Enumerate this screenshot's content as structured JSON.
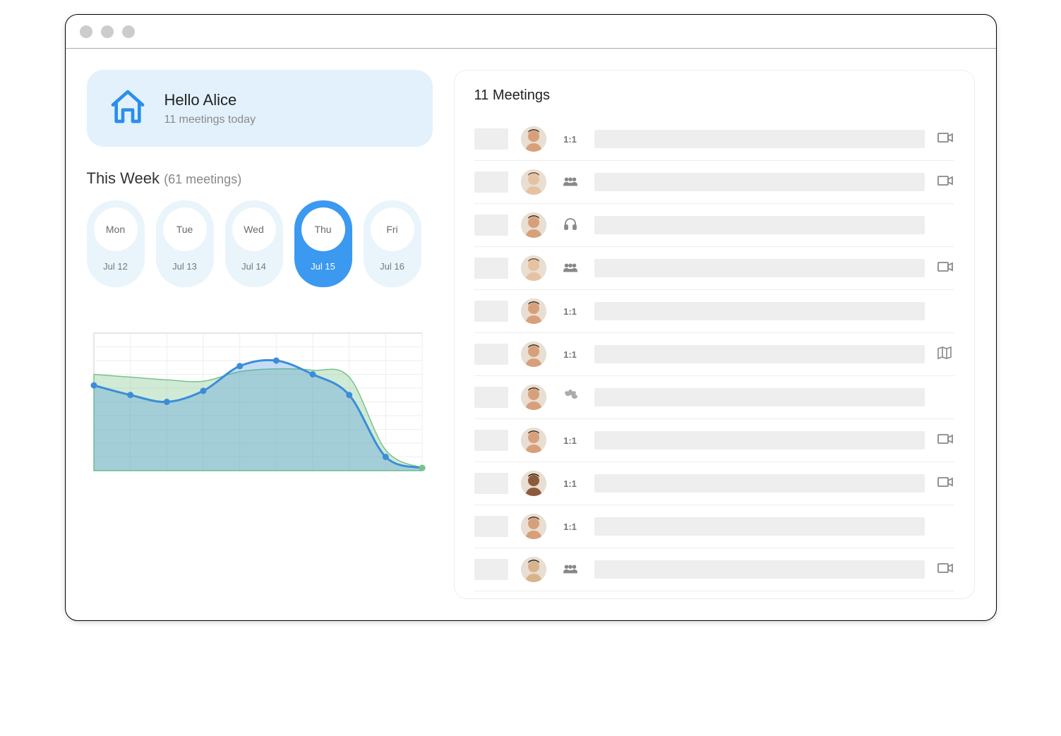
{
  "greeting": {
    "title": "Hello Alice",
    "subtitle": "11 meetings today"
  },
  "week": {
    "label": "This Week",
    "count_label": "(61 meetings)",
    "days": [
      {
        "dow": "Mon",
        "date": "Jul 12",
        "active": false
      },
      {
        "dow": "Tue",
        "date": "Jul 13",
        "active": false
      },
      {
        "dow": "Wed",
        "date": "Jul 14",
        "active": false
      },
      {
        "dow": "Thu",
        "date": "Jul 15",
        "active": true
      },
      {
        "dow": "Fri",
        "date": "Jul 16",
        "active": false
      }
    ]
  },
  "chart_data": {
    "type": "area",
    "x": [
      0,
      1,
      2,
      3,
      4,
      5,
      6,
      7,
      8,
      9
    ],
    "series": [
      {
        "name": "series-blue",
        "color": "#3b8dd9",
        "values": [
          62,
          55,
          50,
          58,
          76,
          80,
          70,
          55,
          10,
          2
        ]
      },
      {
        "name": "series-green",
        "color": "#79c28a",
        "values": [
          70,
          68,
          66,
          65,
          72,
          74,
          73,
          68,
          15,
          2
        ]
      }
    ],
    "ylim": [
      0,
      100
    ],
    "title": "",
    "xlabel": "",
    "ylabel": ""
  },
  "meetings": {
    "heading": "11 Meetings",
    "rows": [
      {
        "avatar": "f1",
        "type": "1:1",
        "action": "video"
      },
      {
        "avatar": "m1",
        "type": "group",
        "action": "video"
      },
      {
        "avatar": "f1",
        "type": "audio",
        "action": ""
      },
      {
        "avatar": "m1",
        "type": "group",
        "action": "video"
      },
      {
        "avatar": "f1",
        "type": "1:1",
        "action": ""
      },
      {
        "avatar": "f1",
        "type": "1:1",
        "action": "map"
      },
      {
        "avatar": "f1",
        "type": "flower",
        "action": ""
      },
      {
        "avatar": "f1",
        "type": "1:1",
        "action": "video"
      },
      {
        "avatar": "f2",
        "type": "1:1",
        "action": "video"
      },
      {
        "avatar": "f1",
        "type": "1:1",
        "action": ""
      },
      {
        "avatar": "m2",
        "type": "group",
        "action": "video"
      }
    ]
  },
  "colors": {
    "accent": "#3b99f0",
    "pill_bg": "#e9f4fb",
    "card_bg": "#e3f1fc"
  }
}
